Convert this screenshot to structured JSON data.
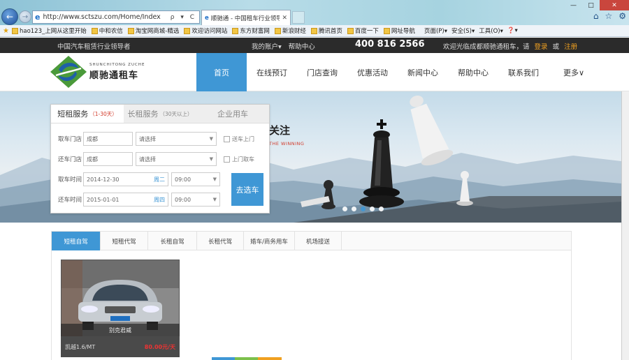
{
  "browser": {
    "url": "http://www.sctszu.com/Home/Index",
    "tab_title": "顺驰通 - 中国租车行业领导者",
    "address_tools": "ρ ▾ C",
    "favorites": [
      "hao123_上网从这里开始",
      "中和农信",
      "淘宝网商城-精选",
      "欢迎访问网站",
      "东方财富网",
      "新浪财经",
      "腾讯首页",
      "百度一下",
      "网址导航"
    ],
    "commands": [
      "页面(P)▾",
      "安全(S)▾",
      "工具(O)▾",
      "❓▾"
    ],
    "icons": [
      "home-icon",
      "star-icon",
      "gear-icon"
    ]
  },
  "topbar": {
    "slogan": "中国汽车租赁行业领导者",
    "links": [
      "我的账户▾",
      "帮助中心"
    ],
    "phone": "400 816 2566",
    "welcome": "欢迎光临成都顺驰通租车，请",
    "login": "登录",
    "or": "或",
    "register": "注册"
  },
  "logo": {
    "pinyin": "SHUNCHITONG ZUCHE",
    "brand": "顺驰通租车"
  },
  "nav": [
    "首页",
    "在线预订",
    "门店查询",
    "优惠活动",
    "新闻中心",
    "帮助中心",
    "联系我们",
    "更多∨"
  ],
  "banner": {
    "slogan_big": "关注",
    "slogan_small": "THE WINNING"
  },
  "booking": {
    "tabs": [
      {
        "label": "短租服务",
        "sub": "（1-30天）"
      },
      {
        "label": "长租服务",
        "sub": "（30天以上）"
      },
      {
        "label": "企业用车",
        "sub": ""
      }
    ],
    "pickup_store_label": "取车门店",
    "pickup_city": "成都",
    "pickup_store": "请选择",
    "pickup_delivery": "送车上门",
    "return_store_label": "还车门店",
    "return_city": "成都",
    "return_store": "请选择",
    "return_collect": "上门取车",
    "pickup_time_label": "取车时间",
    "pickup_date": "2014-12-30",
    "pickup_weekday": "周二",
    "pickup_time": "09:00",
    "return_time_label": "还车时间",
    "return_date": "2015-01-01",
    "return_weekday": "周四",
    "return_time": "09:00",
    "search_button": "去选车"
  },
  "content_tabs": [
    "短租自驾",
    "短租代驾",
    "长租自驾",
    "长租代驾",
    "婚车/商务用车",
    "机场接送"
  ],
  "car": {
    "name": "别克君威",
    "model": "凯越1.6/MT",
    "price": "80.00元/天"
  }
}
